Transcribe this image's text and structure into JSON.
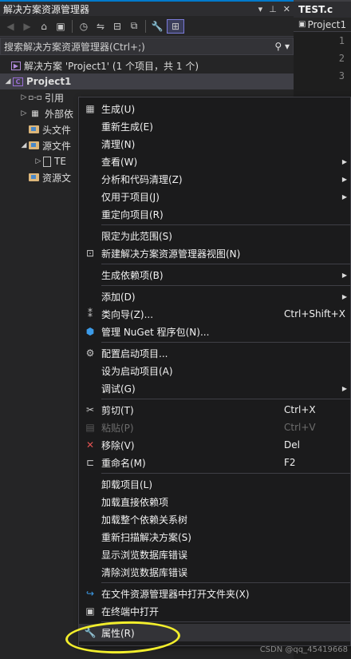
{
  "panel": {
    "title": "解决方案资源管理器",
    "title_controls": [
      "▾",
      "⊥",
      "✕"
    ],
    "search_placeholder": "搜索解决方案资源管理器(Ctrl+;)",
    "search_icon": "search-icon"
  },
  "tree": {
    "solution": "解决方案 'Project1' (1 个项目，共 1 个)",
    "project": "Project1",
    "references": "引用",
    "external": "外部依",
    "headers": "头文件",
    "sources": "源文件",
    "source_file": "TE",
    "resources": "资源文"
  },
  "editor": {
    "tab": "TEST.c",
    "nav": "Project1",
    "line_numbers": [
      "1",
      "2",
      "3"
    ]
  },
  "menu": {
    "build": "生成(U)",
    "rebuild": "重新生成(E)",
    "clean": "清理(N)",
    "view": "查看(W)",
    "analyze": "分析和代码清理(Z)",
    "project_only": "仅用于项目(J)",
    "retarget": "重定向项目(R)",
    "scope": "限定为此范围(S)",
    "new_view": "新建解决方案资源管理器视图(N)",
    "build_deps": "生成依赖项(B)",
    "add": "添加(D)",
    "class_wizard": "类向导(Z)...",
    "class_wizard_key": "Ctrl+Shift+X",
    "nuget": "管理 NuGet 程序包(N)...",
    "config_startup": "配置启动项目...",
    "set_startup": "设为启动项目(A)",
    "debug": "调试(G)",
    "cut": "剪切(T)",
    "cut_key": "Ctrl+X",
    "paste": "粘贴(P)",
    "paste_key": "Ctrl+V",
    "remove": "移除(V)",
    "remove_key": "Del",
    "rename": "重命名(M)",
    "rename_key": "F2",
    "unload": "卸载项目(L)",
    "load_direct": "加载直接依赖项",
    "load_all": "加载整个依赖关系树",
    "rescan": "重新扫描解决方案(S)",
    "show_db_errors": "显示浏览数据库错误",
    "clear_db_errors": "清除浏览数据库错误",
    "open_folder": "在文件资源管理器中打开文件夹(X)",
    "open_terminal": "在终端中打开",
    "properties": "属性(R)"
  },
  "watermark": "CSDN @qq_45419668",
  "colors": {
    "accent": "#007acc",
    "annotation": "#f2ee2c",
    "menu_bg": "#1b1b1c"
  }
}
